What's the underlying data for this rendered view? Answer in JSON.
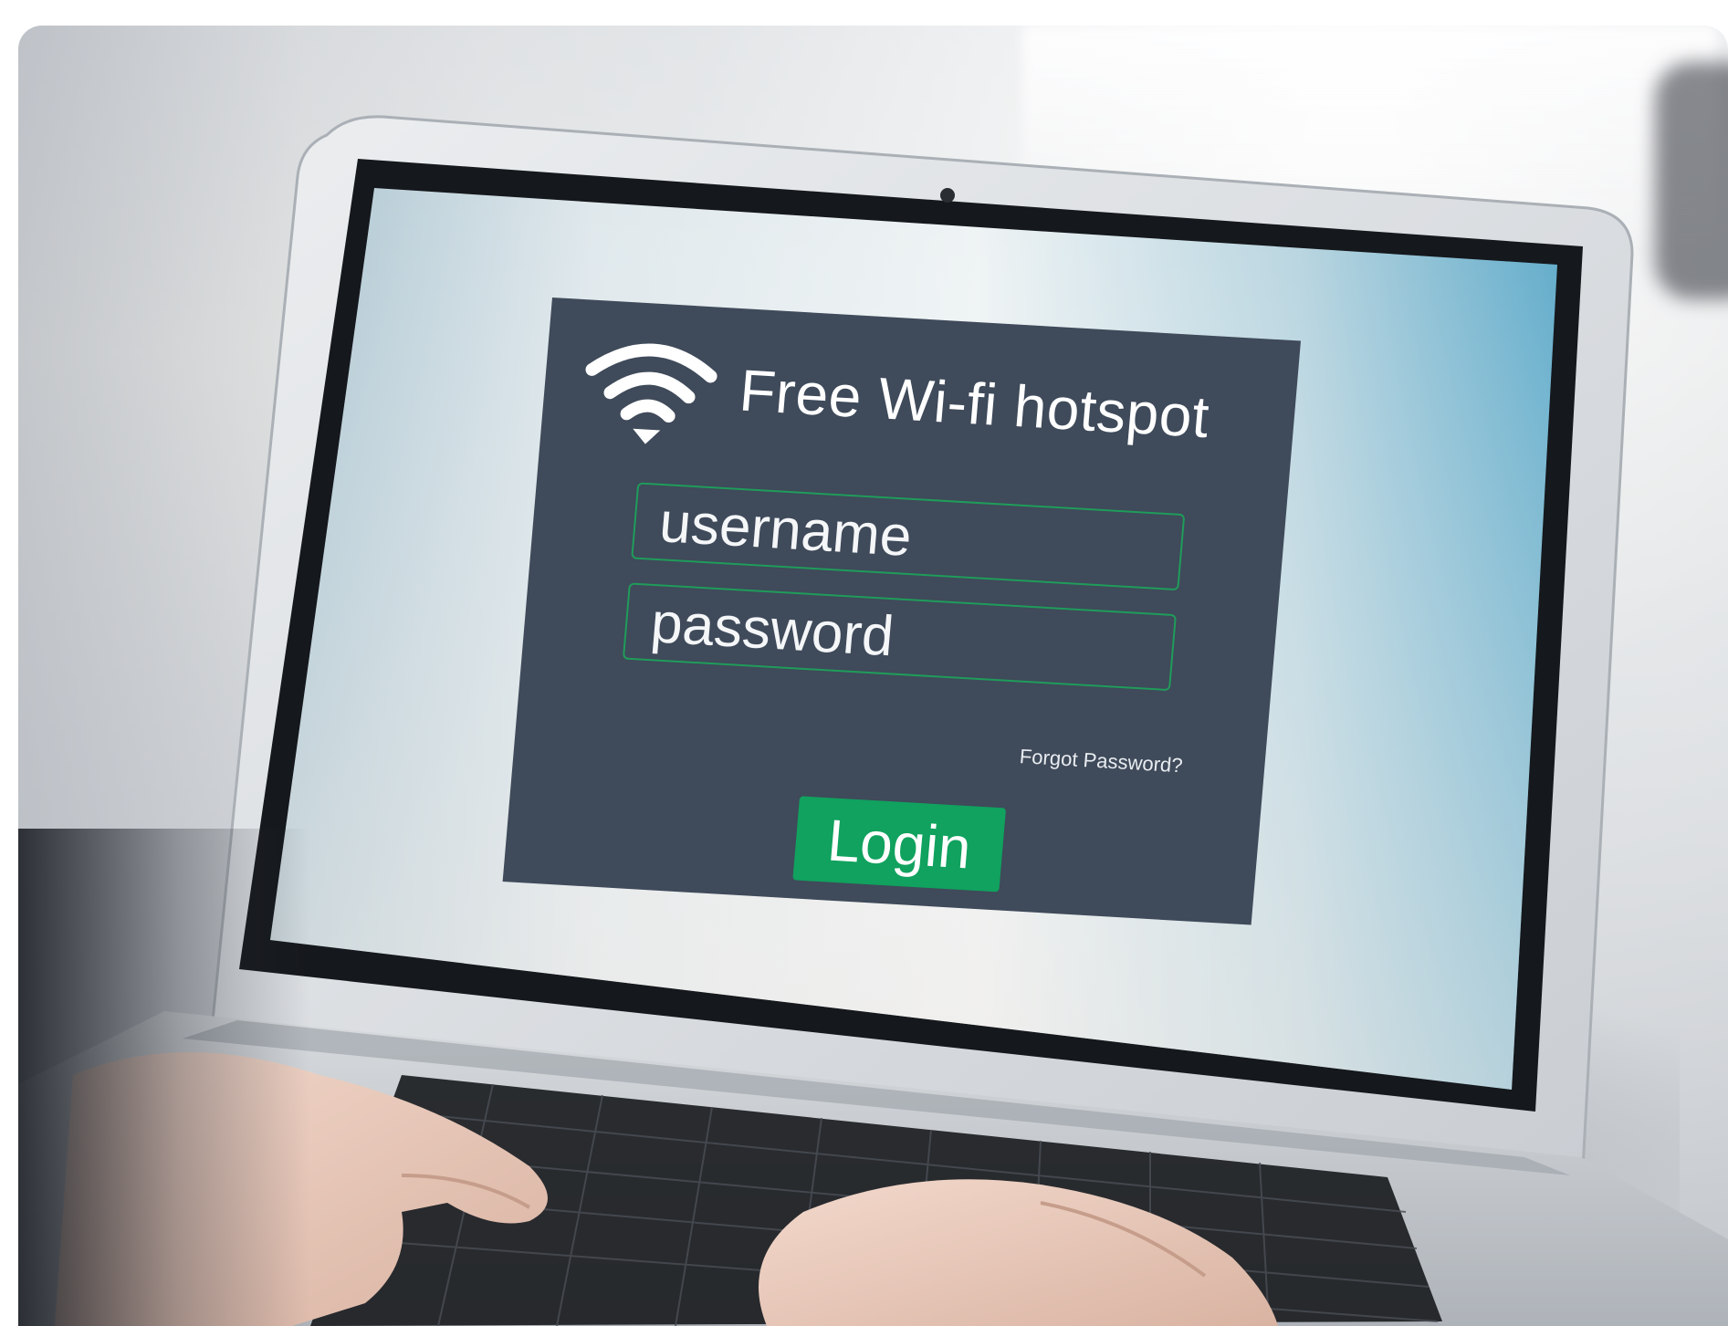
{
  "hotspot_login": {
    "title": "Free Wi-fi hotspot",
    "username_placeholder": "username",
    "password_placeholder": "password",
    "forgot_password_label": "Forgot Password?",
    "login_button_label": "Login",
    "wifi_icon": "wifi-icon"
  },
  "colors": {
    "panel_background": "#3f4a5a",
    "field_border": "#1f9c5a",
    "login_button": "#10a25e",
    "laptop_body": "#d9dcdf",
    "screen_bezel": "#121417"
  }
}
